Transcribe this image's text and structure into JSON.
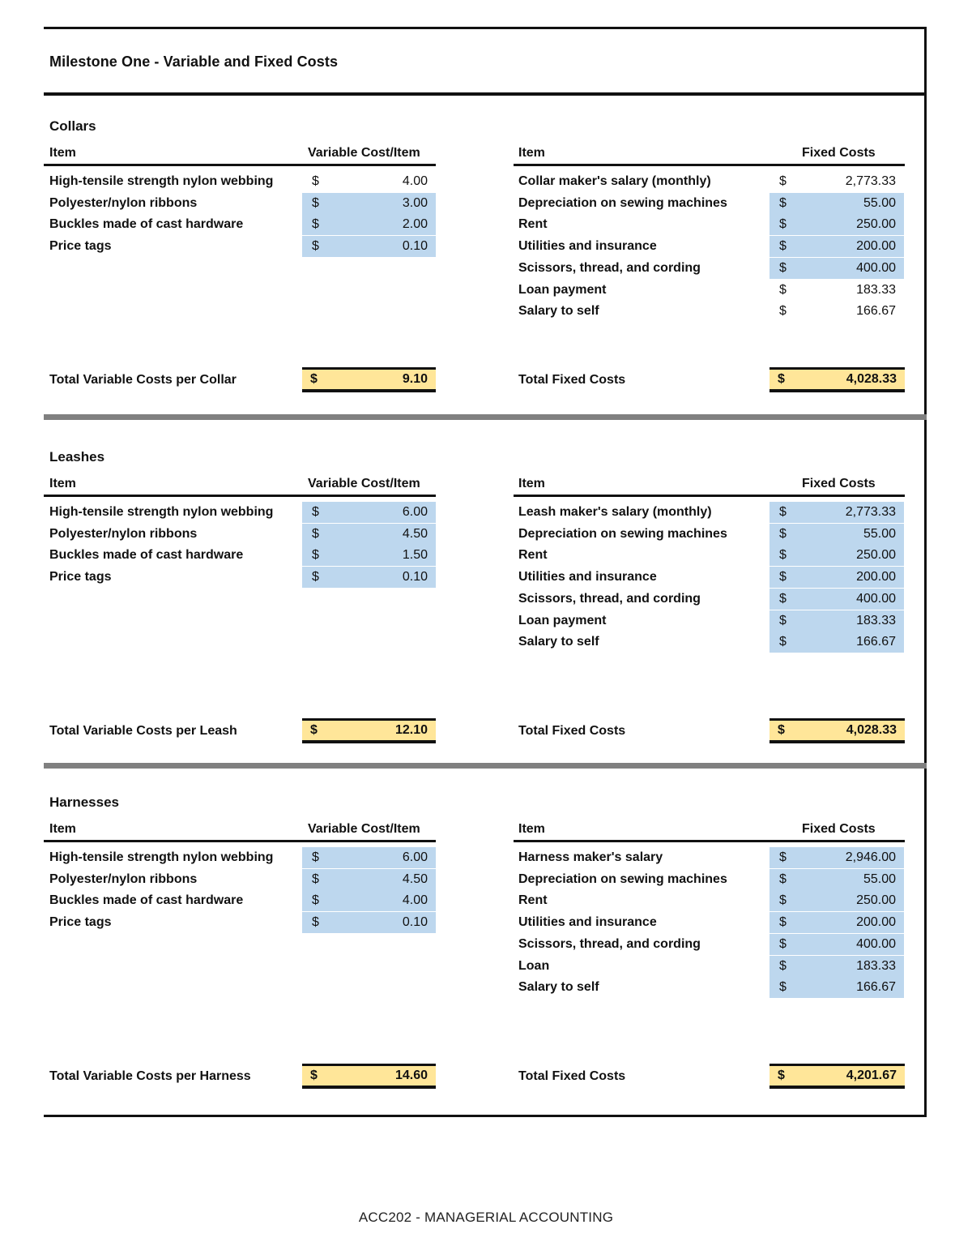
{
  "document": {
    "title": "Milestone One - Variable and Fixed Costs",
    "footer": "ACC202 - MANAGERIAL ACCOUNTING",
    "currency_symbol": "$",
    "colors": {
      "input_highlight": "#bdd7ee",
      "total_highlight": "#ffe699",
      "separator": "#808080"
    }
  },
  "sections": [
    {
      "name": "Collars",
      "variable_header": {
        "item": "Item",
        "value": "Variable Cost/Item"
      },
      "fixed_header": {
        "item": "Item",
        "value": "Fixed Costs"
      },
      "variable_costs": [
        {
          "item": "High-tensile strength nylon webbing",
          "value": "4.00",
          "highlighted": false
        },
        {
          "item": "Polyester/nylon ribbons",
          "value": "3.00",
          "highlighted": true
        },
        {
          "item": "Buckles made of cast hardware",
          "value": "2.00",
          "highlighted": true
        },
        {
          "item": "Price tags",
          "value": "0.10",
          "highlighted": true
        }
      ],
      "fixed_costs": [
        {
          "item": "Collar maker's salary (monthly)",
          "value": "2,773.33",
          "highlighted": false
        },
        {
          "item": "Depreciation on sewing machines",
          "value": "55.00",
          "highlighted": true
        },
        {
          "item": "Rent",
          "value": "250.00",
          "highlighted": true
        },
        {
          "item": "Utilities and insurance",
          "value": "200.00",
          "highlighted": true
        },
        {
          "item": "Scissors, thread, and cording",
          "value": "400.00",
          "highlighted": true
        },
        {
          "item": "Loan payment",
          "value": "183.33",
          "highlighted": false
        },
        {
          "item": "Salary to self",
          "value": "166.67",
          "highlighted": false
        }
      ],
      "total_variable_label": "Total Variable Costs per Collar",
      "total_variable_value": "9.10",
      "total_fixed_label": "Total Fixed Costs",
      "total_fixed_value": "4,028.33"
    },
    {
      "name": "Leashes",
      "variable_header": {
        "item": "Item",
        "value": "Variable Cost/Item"
      },
      "fixed_header": {
        "item": "Item",
        "value": "Fixed Costs"
      },
      "variable_costs": [
        {
          "item": "High-tensile strength nylon webbing",
          "value": "6.00",
          "highlighted": true
        },
        {
          "item": "Polyester/nylon ribbons",
          "value": "4.50",
          "highlighted": true
        },
        {
          "item": "Buckles made of cast hardware",
          "value": "1.50",
          "highlighted": true
        },
        {
          "item": "Price tags",
          "value": "0.10",
          "highlighted": true
        }
      ],
      "fixed_costs": [
        {
          "item": "Leash maker's salary (monthly)",
          "value": "2,773.33",
          "highlighted": true
        },
        {
          "item": "Depreciation on sewing machines",
          "value": "55.00",
          "highlighted": true
        },
        {
          "item": "Rent",
          "value": "250.00",
          "highlighted": true
        },
        {
          "item": "Utilities and insurance",
          "value": "200.00",
          "highlighted": true
        },
        {
          "item": "Scissors, thread, and cording",
          "value": "400.00",
          "highlighted": true
        },
        {
          "item": "Loan payment",
          "value": "183.33",
          "highlighted": true
        },
        {
          "item": "Salary to self",
          "value": "166.67",
          "highlighted": true
        }
      ],
      "total_variable_label": "Total Variable Costs per Leash",
      "total_variable_value": "12.10",
      "total_fixed_label": "Total Fixed Costs",
      "total_fixed_value": "4,028.33"
    },
    {
      "name": "Harnesses",
      "variable_header": {
        "item": "Item",
        "value": "Variable Cost/Item"
      },
      "fixed_header": {
        "item": "Item",
        "value": "Fixed Costs"
      },
      "variable_costs": [
        {
          "item": "High-tensile strength nylon webbing",
          "value": "6.00",
          "highlighted": true
        },
        {
          "item": "Polyester/nylon ribbons",
          "value": "4.50",
          "highlighted": true
        },
        {
          "item": "Buckles made of cast hardware",
          "value": "4.00",
          "highlighted": true
        },
        {
          "item": "Price tags",
          "value": "0.10",
          "highlighted": true
        }
      ],
      "fixed_costs": [
        {
          "item": "Harness maker's salary",
          "value": "2,946.00",
          "highlighted": true
        },
        {
          "item": "Depreciation on sewing machines",
          "value": "55.00",
          "highlighted": true
        },
        {
          "item": "Rent",
          "value": "250.00",
          "highlighted": true
        },
        {
          "item": "Utilities and insurance",
          "value": "200.00",
          "highlighted": true
        },
        {
          "item": "Scissors, thread, and cording",
          "value": "400.00",
          "highlighted": true
        },
        {
          "item": "Loan",
          "value": "183.33",
          "highlighted": true
        },
        {
          "item": "Salary to self",
          "value": "166.67",
          "highlighted": true
        }
      ],
      "total_variable_label": "Total Variable Costs per Harness",
      "total_variable_value": "14.60",
      "total_fixed_label": "Total Fixed Costs",
      "total_fixed_value": "4,201.67"
    }
  ]
}
